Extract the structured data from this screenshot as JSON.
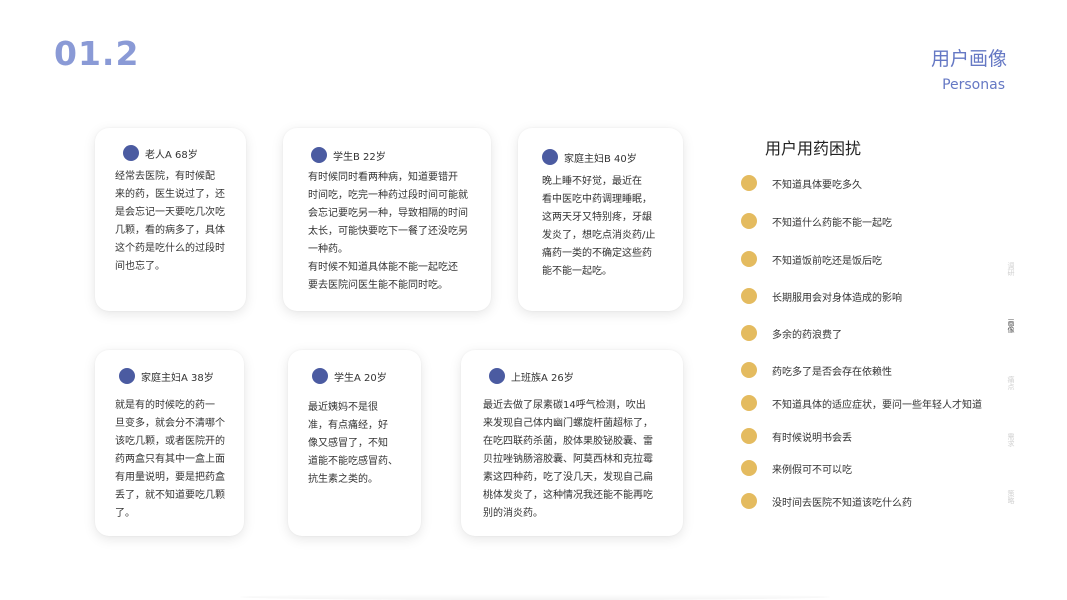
{
  "header": {
    "section_number": "01.2",
    "title": "用户画像",
    "subtitle": "Personas"
  },
  "personas": [
    {
      "name": "老人A  68岁",
      "text": "    经常去医院，有时候配\n来的药，医生说过了，还\n是会忘记一天要吃几次吃\n几颗，看的病多了，具体\n这个药是吃什么的过段时\n间也忘了。"
    },
    {
      "name": "学生B 22岁",
      "text": "    有时候同时看两种病，知道要错开\n时间吃，吃完一种药过段时间可能就\n会忘记要吃另一种，导致相隔的时间\n太长，可能快要吃下一餐了还没吃另\n一种药。\n    有时候不知道具体能不能一起吃还\n要去医院问医生能不能同时吃。"
    },
    {
      "name": "家庭主妇B 40岁",
      "text": "    晚上睡不好觉，最近在\n看中医吃中药调理睡眠，\n这两天牙又特别疼，牙龈\n发炎了，想吃点消炎药/止\n痛药一类的不确定这些药\n能不能一起吃。"
    },
    {
      "name": "家庭主妇A  38岁",
      "text": "    就是有的时候吃的药一\n旦变多，就会分不清哪个\n该吃几颗，或者医院开的\n药两盒只有其中一盒上面\n有用量说明，要是把药盒\n丢了，就不知道要吃几颗\n了。"
    },
    {
      "name": "学生A  20岁",
      "text": "    最近姨妈不是很\n准，有点痛经，好\n像又感冒了，不知\n道能不能吃感冒药、\n抗生素之类的。"
    },
    {
      "name": "上班族A 26岁",
      "text": "    最近去做了尿素碳14呼气检测，吹出\n来发现自己体内幽门螺旋杆菌超标了，\n在吃四联药杀菌，胶体果胶铋胶囊、雷\n贝拉唑钠肠溶胶囊、阿莫西林和克拉霉\n素这四种药，吃了没几天，发现自己扁\n桃体发炎了，这种情况我还能不能再吃\n别的消炎药。"
    }
  ],
  "worries": {
    "title": "用户用药困扰",
    "items": [
      "不知道具体要吃多久",
      "不知道什么药能不能一起吃",
      "不知道饭前吃还是饭后吃",
      "长期服用会对身体造成的影响",
      "多余的药浪费了",
      "药吃多了是否会存在依赖性",
      "不知道具体的适应症状，要问一些年轻人才知道",
      "有时候说明书会丢",
      "来例假可不可以吃",
      "没时间去医院不知道该吃什么药"
    ]
  },
  "side_nav": [
    "调研",
    "画像",
    "痛点",
    "需求",
    "策略"
  ],
  "colors": {
    "accent": "#6578c4",
    "persona_dot": "#4b5ba1",
    "worry_dot": "#e4bb5f"
  }
}
